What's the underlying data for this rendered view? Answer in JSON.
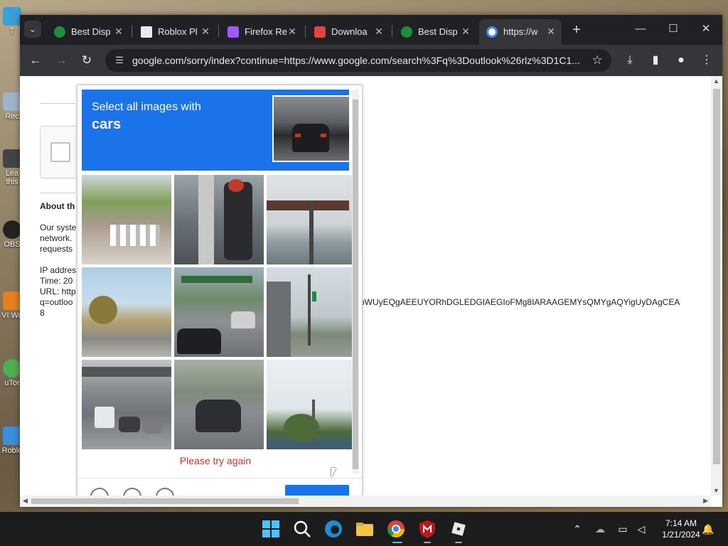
{
  "desktop": {
    "icons": [
      "T",
      "Rec",
      "Lea this",
      "OBS",
      "VI Wo",
      "uTor",
      "Roblo"
    ]
  },
  "browser": {
    "tabs": [
      {
        "title": "Best Disp",
        "favicon_color": "#1e8e3e"
      },
      {
        "title": "Roblox Pl",
        "favicon_color": "#e8eaed"
      },
      {
        "title": "Firefox Re",
        "favicon_color": "#9b59ff"
      },
      {
        "title": "Downloa",
        "favicon_color": "#e0443e"
      },
      {
        "title": "Best Disp",
        "favicon_color": "#1e8e3e"
      },
      {
        "title": "https://w",
        "favicon_color": "#4285f4"
      }
    ],
    "url": "google.com/sorry/index?continue=https://www.google.com/search%3Fq%3Doutlook%26rlz%3D1C1..."
  },
  "page": {
    "text_about": "About th",
    "text_body": [
      "Our syste",
      "network.",
      "requests"
    ],
    "text_ip": [
      "IP addres",
      "Time: 20",
      "URL: http",
      "q=outloo",
      "8"
    ],
    "long_url": "oWUyEQgAEEUYORhDGLEDGIAEGIoFMg8IARAAGEMYsQMYgAQYigUyDAgCEA"
  },
  "captcha": {
    "prompt": "Select all images with",
    "target": "cars",
    "error": "Please try again"
  },
  "taskbar": {
    "time": "7:14 AM",
    "date": "1/21/2024"
  },
  "colors": {
    "accent": "#1a73e8",
    "error": "#c0392b",
    "chrome_dark": "#202124",
    "chrome_toolbar": "#35363a"
  }
}
